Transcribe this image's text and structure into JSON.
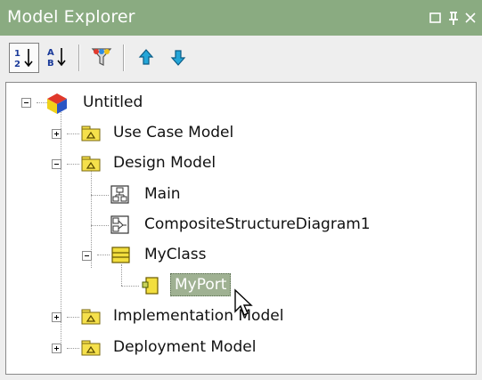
{
  "window": {
    "title": "Model Explorer",
    "accent": "#8aab81"
  },
  "toolbar": {
    "items": [
      {
        "name": "sort-by-order-button",
        "icon": "sort-numeric-icon"
      },
      {
        "name": "sort-alphabetical-button",
        "icon": "sort-alpha-icon"
      },
      {
        "name": "filter-button",
        "icon": "filter-icon"
      },
      {
        "name": "move-up-button",
        "icon": "arrow-up-icon"
      },
      {
        "name": "move-down-button",
        "icon": "arrow-down-icon"
      }
    ]
  },
  "tree": {
    "root": {
      "label": "Untitled",
      "expanded": true,
      "icon": "project-cube-icon"
    },
    "items": [
      {
        "label": "Use Case Model",
        "expanded": false,
        "icon": "package-icon"
      },
      {
        "label": "Design Model",
        "expanded": true,
        "icon": "package-icon"
      },
      {
        "label": "Main",
        "icon": "class-diagram-icon"
      },
      {
        "label": "CompositeStructureDiagram1",
        "icon": "composite-diagram-icon"
      },
      {
        "label": "MyClass",
        "expanded": true,
        "icon": "class-icon"
      },
      {
        "label": "MyPort",
        "selected": true,
        "icon": "port-icon"
      },
      {
        "label": "Implementation Model",
        "expanded": false,
        "icon": "package-icon"
      },
      {
        "label": "Deployment Model",
        "expanded": false,
        "icon": "package-icon"
      }
    ]
  },
  "colors": {
    "selection": "#9fb192",
    "package": "#f5e04b"
  }
}
